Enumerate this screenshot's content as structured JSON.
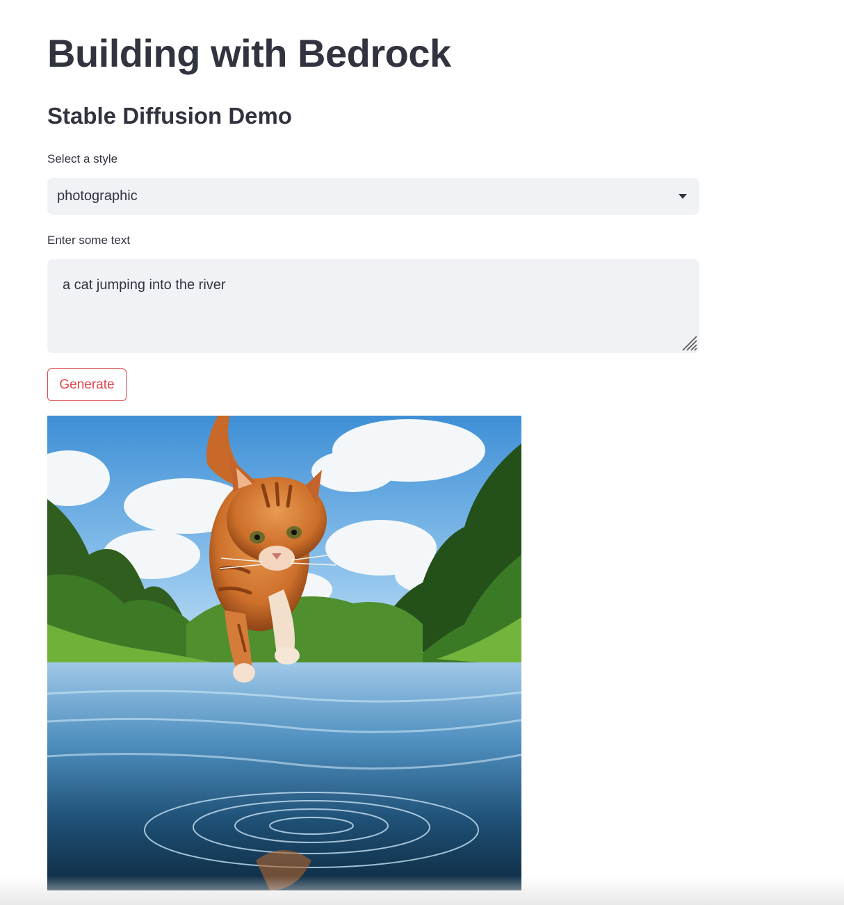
{
  "app": {
    "title": "Building with Bedrock",
    "subtitle": "Stable Diffusion Demo"
  },
  "style_select": {
    "label": "Select a style",
    "value": "photographic",
    "icon": "chevron-down-icon"
  },
  "prompt_input": {
    "label": "Enter some text",
    "value": "a cat jumping into the river",
    "icon": "resize-handle-icon"
  },
  "generate_button": {
    "label": "Generate",
    "color": "#e0474c"
  },
  "theme": {
    "text": "#31333f",
    "input_bg": "#f0f2f6",
    "accent": "#e0474c"
  }
}
